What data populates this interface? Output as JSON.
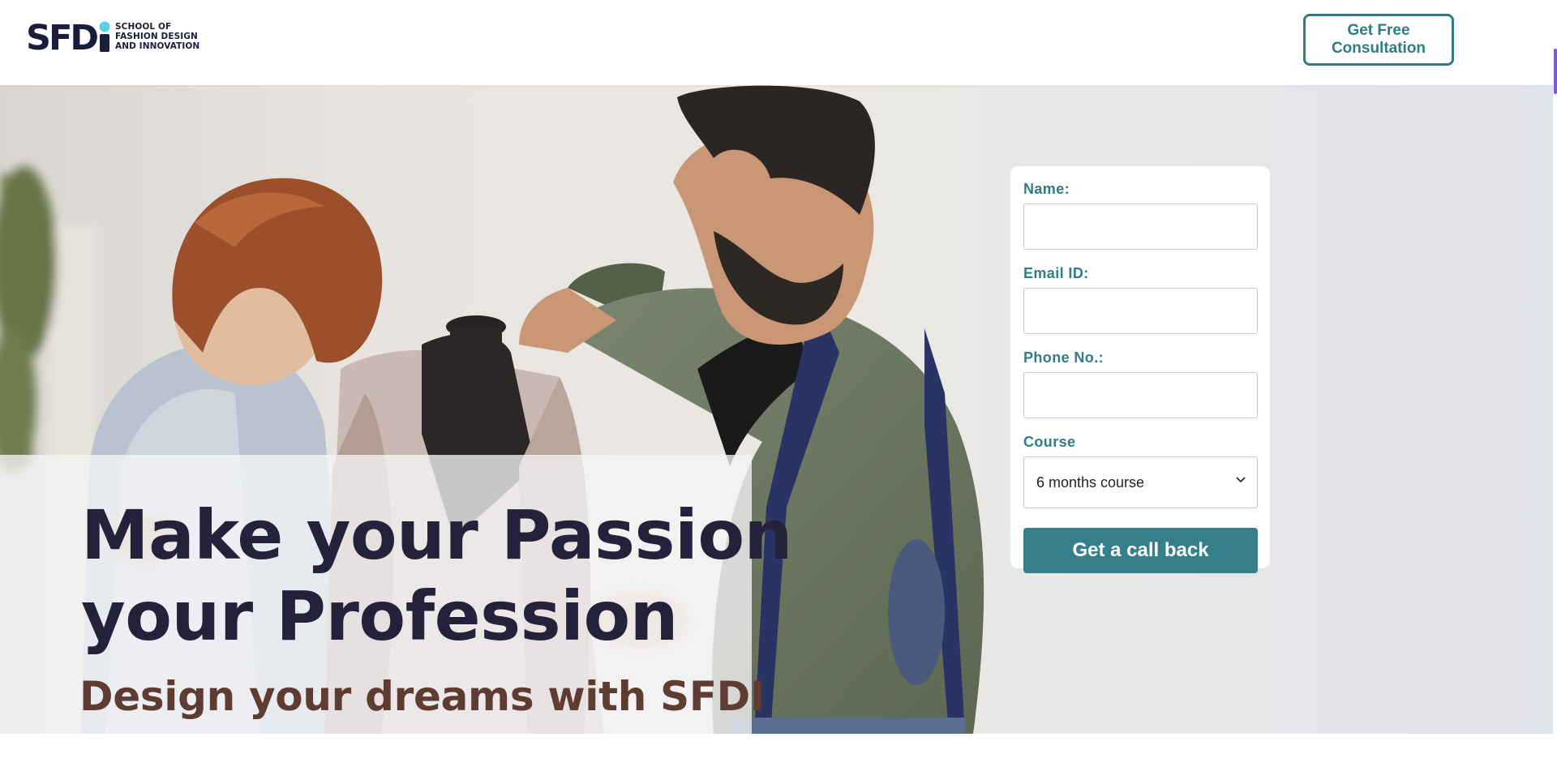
{
  "header": {
    "logo_lines": [
      "SCHOOL OF",
      "FASHION DESIGN",
      "AND INNOVATION"
    ],
    "logo_mark": "SFDi",
    "cta_label": "Get Free Consultation"
  },
  "hero": {
    "title_line1": "Make your Passion",
    "title_line2": "your Profession",
    "subtitle": "Design your dreams with SFDI"
  },
  "form": {
    "name_label": "Name:",
    "name_value": "",
    "email_label": "Email ID:",
    "email_value": "",
    "phone_label": "Phone No.:",
    "phone_value": "",
    "course_label": "Course",
    "course_selected": "6 months course",
    "submit_label": "Get a call back"
  },
  "colors": {
    "accent": "#2f7c85",
    "button": "#35808a",
    "title": "#24213a",
    "subtitle": "#5e3c32",
    "logo_dot": "#57d0e0",
    "logo_dark": "#1b1d3c"
  }
}
